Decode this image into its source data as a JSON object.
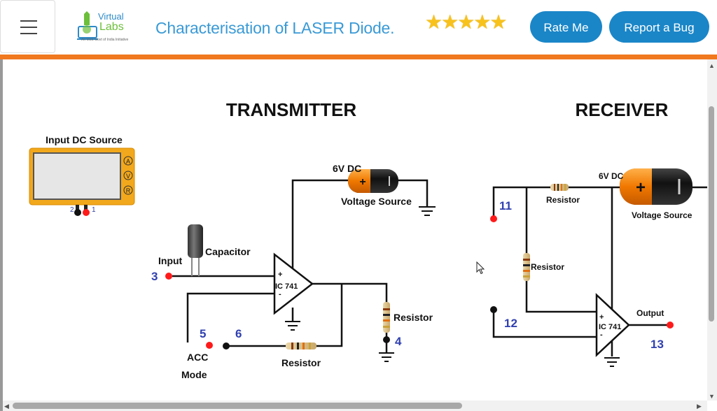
{
  "header": {
    "menu_icon": "hamburger-icon",
    "logo_line1": "Virtual",
    "logo_line2": "Labs",
    "logo_tagline": "An MoE Govt of India Initiative",
    "title": "Characterisation of LASER Diode.",
    "rating_stars": 5,
    "stars_text": "★★★★★",
    "rate_button": "Rate Me",
    "bug_button": "Report a Bug"
  },
  "colors": {
    "brand_blue": "#1a86c8",
    "title_blue": "#3a9ad6",
    "orange_bar": "#f0781e",
    "star": "#f8c21c",
    "terminal_red": "#ff1a1a"
  },
  "transmitter": {
    "heading": "TRANSMITTER",
    "dc_source_label": "Input DC Source",
    "meter_buttons": [
      "A",
      "V",
      "R"
    ],
    "meter_terminals": [
      "2",
      "1"
    ],
    "supply_label": "6V DC",
    "battery_label": "Voltage Source",
    "capacitor_label": "Capacitor",
    "input_label": "Input",
    "terminal_3": "3",
    "opamp_label": "IC 741",
    "opamp_plus": "+",
    "opamp_minus": "-",
    "resistor_label_right": "Resistor",
    "terminal_4": "4",
    "terminal_5": "5",
    "terminal_6": "6",
    "acc_label": "ACC",
    "mode_label": "Mode",
    "resistor_label_bottom": "Resistor"
  },
  "receiver": {
    "heading": "RECEIVER",
    "supply_label": "6V DC",
    "battery_label": "Voltage Source",
    "resistor_top_label": "Resistor",
    "resistor_mid_label": "Resistor",
    "terminal_11": "11",
    "terminal_12": "12",
    "terminal_13": "13",
    "opamp_label": "IC 741",
    "opamp_plus": "+",
    "opamp_minus": "-",
    "output_label": "Output"
  }
}
